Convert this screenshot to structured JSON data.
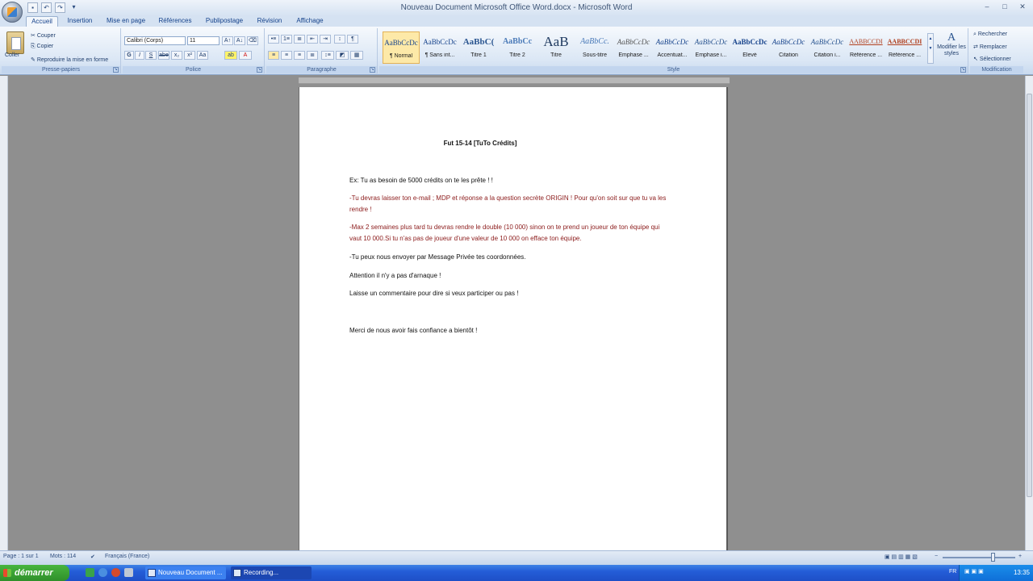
{
  "window": {
    "title": "Nouveau Document Microsoft Office Word.docx - Microsoft Word"
  },
  "tabs": [
    "Accueil",
    "Insertion",
    "Mise en page",
    "Références",
    "Publipostage",
    "Révision",
    "Affichage"
  ],
  "clipboard": {
    "paste_label": "Coller",
    "cut_label": "Couper",
    "copy_label": "Copier",
    "format_painter_label": "Reproduire la mise en forme",
    "group_label": "Presse-papiers"
  },
  "font": {
    "font_name": "Calibri (Corps)",
    "font_size": "11",
    "group_label": "Police"
  },
  "paragraph": {
    "group_label": "Paragraphe"
  },
  "styles": {
    "group_label": "Style",
    "items": [
      {
        "sample": "AaBbCcDc",
        "name": "¶ Normal"
      },
      {
        "sample": "AaBbCcDc",
        "name": "¶ Sans int..."
      },
      {
        "sample": "AaBbC(",
        "name": "Titre 1"
      },
      {
        "sample": "AaBbCc",
        "name": "Titre 2"
      },
      {
        "sample": "AaB",
        "name": "Titre"
      },
      {
        "sample": "AaBbCc.",
        "name": "Sous-titre"
      },
      {
        "sample": "AaBbCcDc",
        "name": "Emphase ..."
      },
      {
        "sample": "AaBbCcDc",
        "name": "Accentuat..."
      },
      {
        "sample": "AaBbCcDc",
        "name": "Emphase i..."
      },
      {
        "sample": "AaBbCcDc",
        "name": "Élevé"
      },
      {
        "sample": "AaBbCcDc",
        "name": "Citation"
      },
      {
        "sample": "AaBbCcDc",
        "name": "Citation i..."
      },
      {
        "sample": "AABBCCDI",
        "name": "Référence ..."
      },
      {
        "sample": "AABBCCDI",
        "name": "Référence ..."
      }
    ],
    "modify_label": "Modifier les styles"
  },
  "editing": {
    "find_label": "Rechercher",
    "replace_label": "Remplacer",
    "select_label": "Sélectionner",
    "group_label": "Modification"
  },
  "document": {
    "title": "Fut 15-14 [TuTo Crédits]",
    "line1": "Ex: Tu as besoin de 5000 crédits on te les prête ! !",
    "line2": "-Tu devras laisser ton e-mail ; MDP et réponse a la question secrète ORIGIN ! Pour qu'on soit sur que tu va les rendre !",
    "line3": "-Max 2 semaines plus tard tu devras rendre le double (10 000) sinon on te prend un joueur de ton équipe qui vaut 10 000.Si tu n'as pas de joueur d'une valeur de 10 000 on efface ton équipe.",
    "line4": "-Tu peux nous envoyer par Message Privée tes coordonnées.",
    "line5": "Attention il n'y a pas d'arnaque !",
    "line6": "Laisse un commentaire pour dire si veux participer ou pas !",
    "line7": "Merci de nous avoir fais confiance a bientôt !"
  },
  "status": {
    "page": "Page : 1 sur 1",
    "words": "Mots : 114",
    "language": "Français (France)"
  },
  "taskbar": {
    "start_label": "démarrer",
    "task1_label": "Nouveau Document ...",
    "task2_label": "Recording...",
    "lang": "FR",
    "clock": "13:35"
  }
}
